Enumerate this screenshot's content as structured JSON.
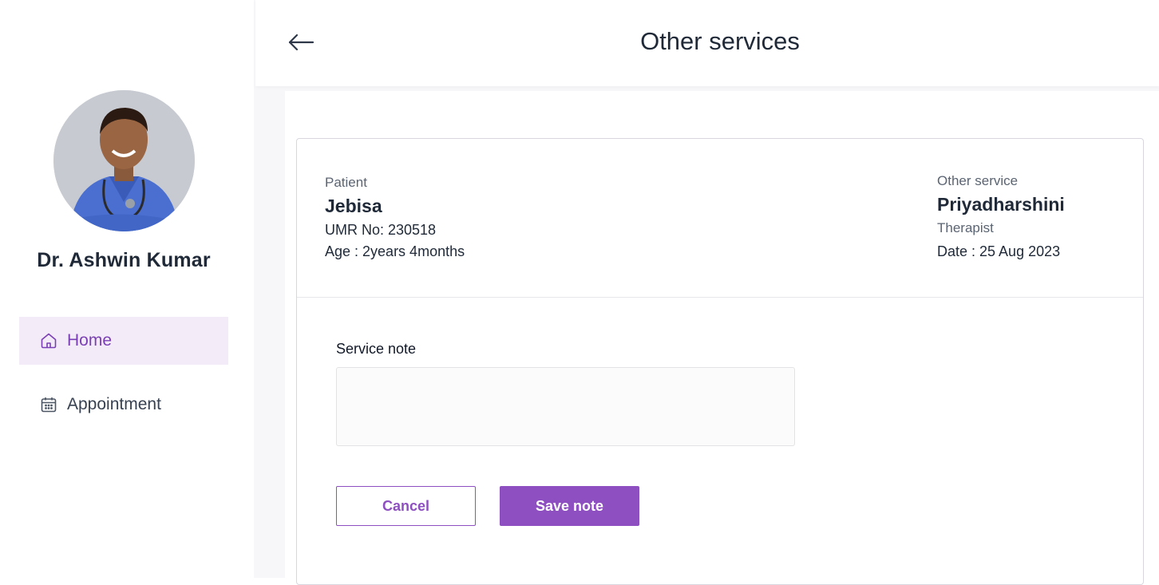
{
  "sidebar": {
    "doctor_name": "Dr. Ashwin Kumar",
    "avatar_alt": "doctor profile photo",
    "items": [
      {
        "label": "Home",
        "icon": "home-icon",
        "active": true
      },
      {
        "label": "Appointment",
        "icon": "calendar-icon",
        "active": false
      }
    ]
  },
  "header": {
    "title": "Other services",
    "back_icon": "arrow-left-icon"
  },
  "patient": {
    "label": "Patient",
    "name": "Jebisa",
    "umr": "UMR No: 230518",
    "age": "Age : 2years 4months"
  },
  "service": {
    "label": "Other service",
    "name": "Priyadharshini",
    "role": "Therapist",
    "date": "Date : 25 Aug 2023"
  },
  "note": {
    "label": "Service note",
    "value": "",
    "placeholder": ""
  },
  "actions": {
    "cancel_label": "Cancel",
    "save_label": "Save note"
  },
  "colors": {
    "accent": "#8e4fc1",
    "active_nav_bg": "#f3ecf8",
    "active_nav_text": "#7b3fb5"
  }
}
